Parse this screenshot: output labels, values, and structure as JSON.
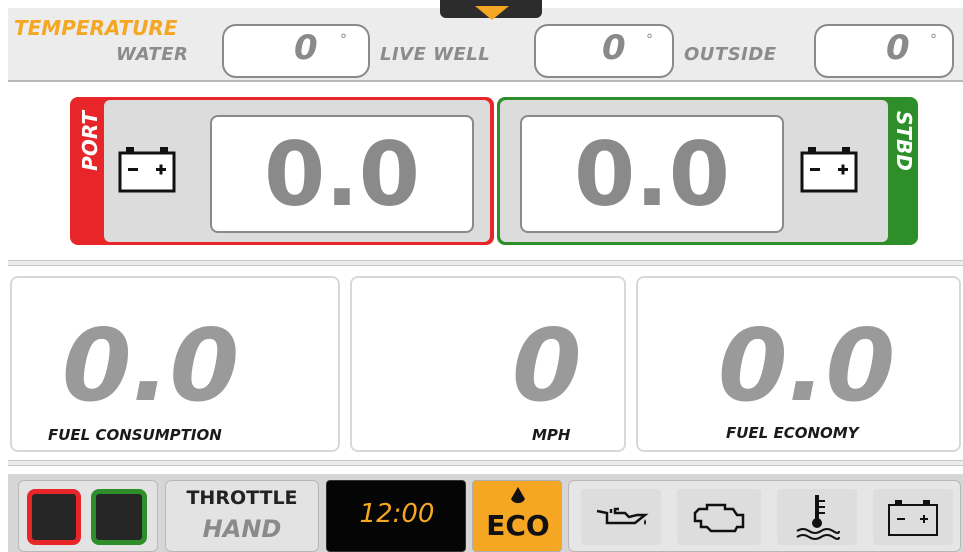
{
  "temperature": {
    "title": "TEMPERATURE",
    "water": {
      "label": "WATER",
      "value": "0",
      "unit": "°"
    },
    "live_well": {
      "label": "LIVE WELL",
      "value": "0",
      "unit": "°"
    },
    "outside": {
      "label": "OUTSIDE",
      "value": "0",
      "unit": "°"
    }
  },
  "battery": {
    "port": {
      "label": "PORT",
      "value": "0.0",
      "color": "#e8262a"
    },
    "stbd": {
      "label": "STBD",
      "value": "0.0",
      "color": "#2e8f2a"
    }
  },
  "gauges": {
    "fuel_consumption": {
      "value": "0.0",
      "label": "FUEL CONSUMPTION"
    },
    "speed": {
      "value": "0",
      "label": "MPH"
    },
    "fuel_economy": {
      "value": "0.0",
      "label": "FUEL ECONOMY"
    }
  },
  "bottom": {
    "throttle_title": "THROTTLE",
    "throttle_mode": "HAND",
    "clock": "12:00",
    "eco_label": "ECO",
    "indicator_colors": {
      "red": "#e8262a",
      "green": "#2e8f2a"
    },
    "icons": [
      "oil-pressure-icon",
      "engine-check-icon",
      "coolant-temp-icon",
      "battery-icon"
    ]
  },
  "colors": {
    "accent": "#f5a623",
    "gray_text": "#8a8a8a"
  }
}
